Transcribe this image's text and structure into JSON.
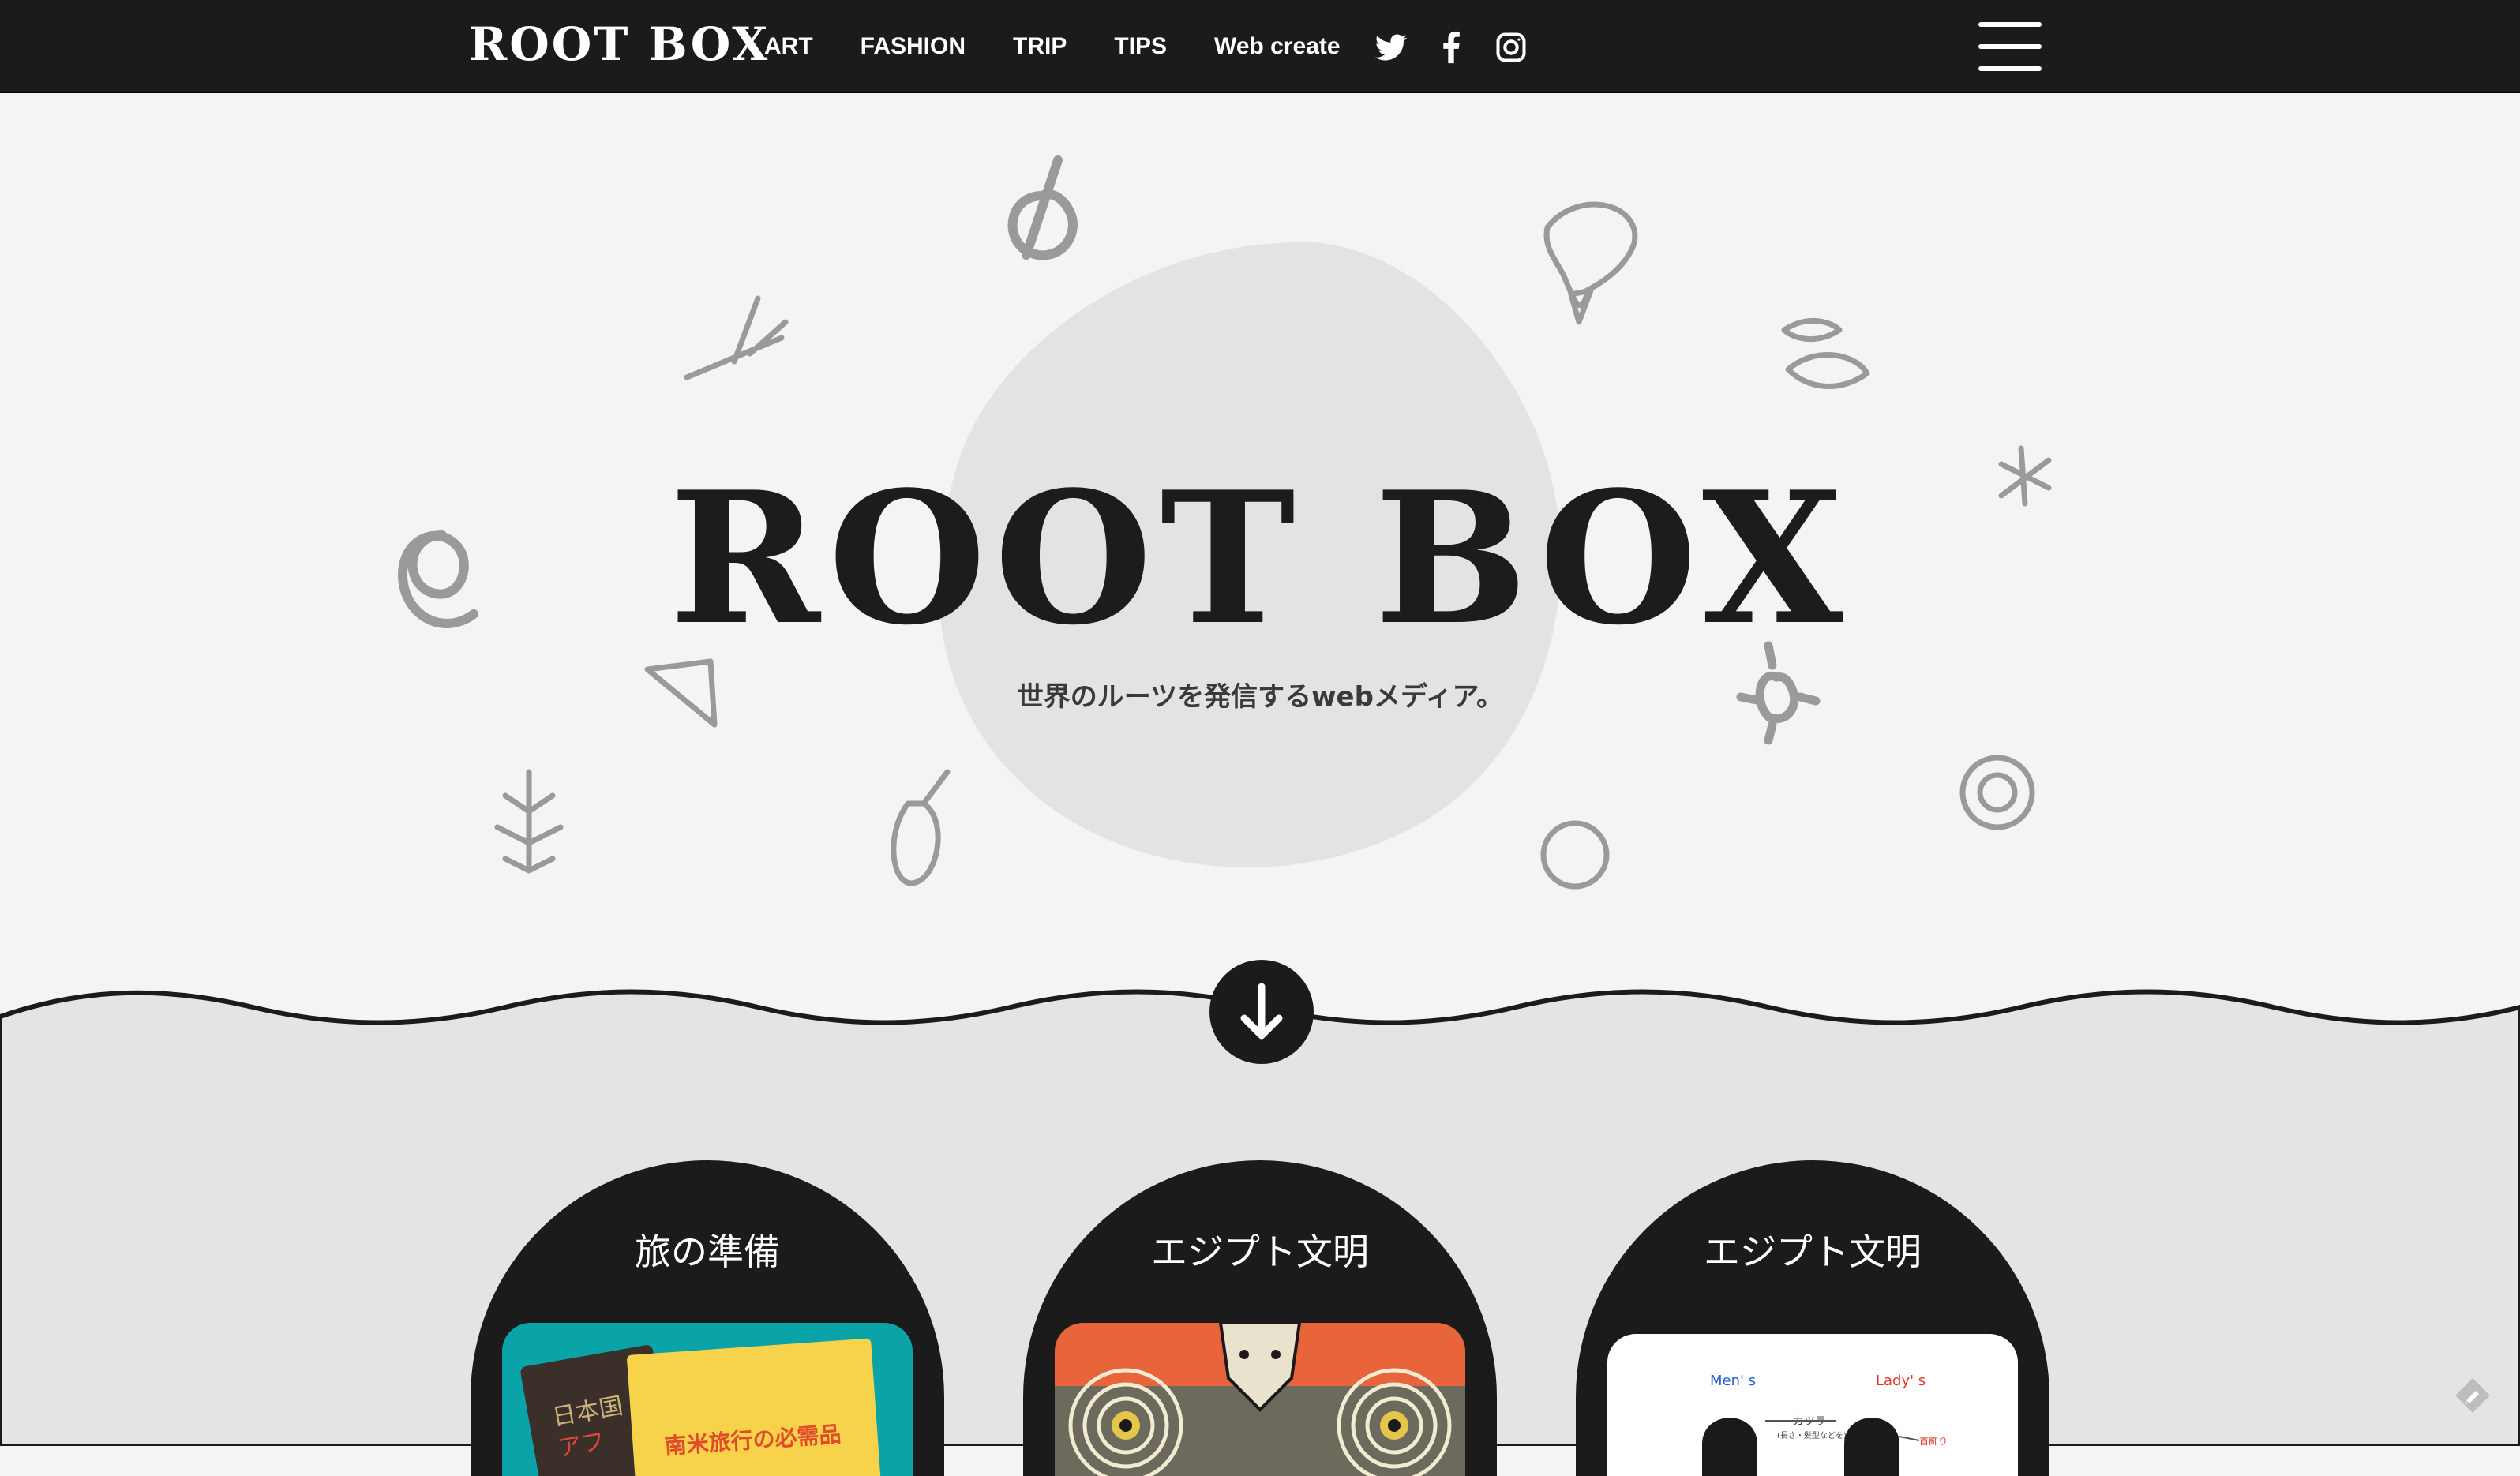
{
  "header": {
    "logo": "ROOT BOX",
    "nav": [
      {
        "label": "ART"
      },
      {
        "label": "FASHION"
      },
      {
        "label": "TRIP"
      },
      {
        "label": "TIPS"
      },
      {
        "label": "Web create"
      }
    ],
    "social": [
      "twitter-icon",
      "facebook-icon",
      "instagram-icon"
    ],
    "menu_icon": "hamburger-menu-icon"
  },
  "hero": {
    "title": "ROOT BOX",
    "subtitle": "世界のルーツを発信するwebメディア。"
  },
  "scroll_button": {
    "icon": "arrow-down-icon"
  },
  "cards": [
    {
      "title": "旅の準備",
      "thumb_text_1": "日本国",
      "thumb_text_2": "南米旅行の必需品",
      "thumb_text_3": "アフ"
    },
    {
      "title": "エジプト文明"
    },
    {
      "title": "エジプト文明",
      "thumb_left_label": "Men' s",
      "thumb_right_label": "Lady' s",
      "thumb_note_1": "カツラ",
      "thumb_note_2": "(長さ・髪型などを)",
      "thumb_note_3": "首飾り"
    }
  ],
  "colors": {
    "header_bg": "#1b1b1b",
    "hero_bg": "#f4f4f4",
    "lower_bg": "#e4e4e4",
    "accent_dark": "#1b1b1b",
    "thumb_teal": "#0aa3a8",
    "thumb_orange": "#e8643a"
  },
  "edit_icon": "pencil-edit-icon"
}
